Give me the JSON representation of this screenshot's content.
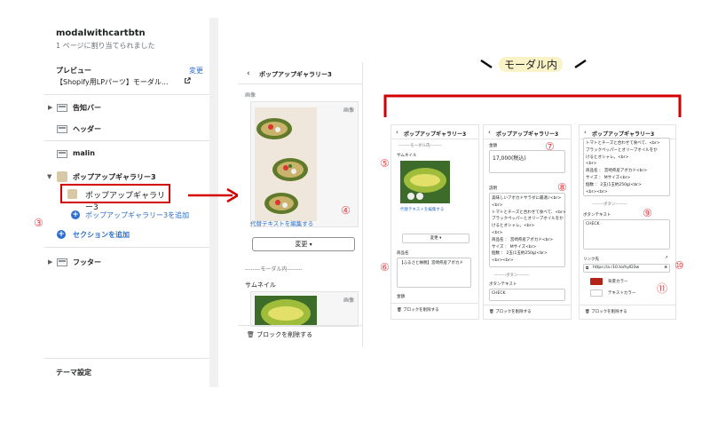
{
  "sidebar": {
    "title": "modalwithcartbtn",
    "subtitle": "1 ページに割り当てられました",
    "preview_label": "プレビュー",
    "change_link": "変更",
    "preview_value": "【Shopify用LPパーツ】モーダル...",
    "sections": {
      "announcement": "告知バー",
      "header": "ヘッダー",
      "malin": "malin",
      "popup_gallery": "ポップアップギャラリー3",
      "popup_block": "ポップアップギャラリー3",
      "add_block": "ポップアップギャラリー3を追加",
      "add_section": "セクションを追加",
      "footer": "フッター"
    },
    "theme_settings": "テーマ設定",
    "marker_3": "③"
  },
  "middle": {
    "header": "ポップアップギャラリー3",
    "image_label": "画像",
    "image_badge": "画像",
    "alt_text_link": "代替テキストを編集する",
    "marker_4": "④",
    "change_button": "変更",
    "modal_divider": "--------モーダル内--------",
    "thumbnail_label": "サムネイル",
    "thumb_badge": "画像",
    "delete_block": "ブロックを削除する"
  },
  "heading": {
    "title": "モーダル内",
    "accent_color": "#d40000"
  },
  "shot1": {
    "header": "ポップアップギャラリー3",
    "divider": "--------モーダル内--------",
    "thumbnail_label": "サムネイル",
    "alt_link": "代替テキストを編集する",
    "change": "変更",
    "product_label": "商品名",
    "product_value": "【ふるさと納税】宮崎県産アボカド",
    "price_label": "金額",
    "delete": "ブロックを削除する",
    "marker_5": "⑤",
    "marker_6": "⑥"
  },
  "shot2": {
    "header": "ポップアップギャラリー3",
    "price_label": "金額",
    "price_value": "17,000(税込)",
    "desc_label": "説明",
    "desc_lines": [
      "美味しいアボカドサラダに最適♪<br>",
      "<br>",
      "トマトとチーズと合わせて食べて、<br>",
      "ブラックペッパーとオリーブオイルをか",
      "けるとオシャレ。<br>",
      "<br>",
      "商品名  ：  宮崎県産アボカド<br>",
      "サイズ  ：  Mサイズ<br>",
      "個数  ：  2玉(1玉約250g)<br>",
      "<br><br>"
    ],
    "button_divider": "--------ボタン--------",
    "button_text_label": "ボタンテキスト",
    "button_text_value": "CHECK",
    "delete": "ブロックを削除する",
    "marker_7": "⑦",
    "marker_8": "⑧"
  },
  "shot3": {
    "header": "ポップアップギャラリー3",
    "desc_lines": [
      "トマトとチーズと合わせて食べて、<br>",
      "ブラックペッパーとオリーブオイルをか",
      "けるとオシャレ。<br>",
      "<br>",
      "商品名  ：  宮崎県産アボカド<br>",
      "サイズ  ：  Mサイズ<br>",
      "個数  ：  2玉(1玉約250g)<br>",
      "<br><br>"
    ],
    "button_divider": "--------ボタン--------",
    "button_text_label": "ボタンテキスト",
    "button_text_value": "CHECK",
    "link_label": "リンク先",
    "link_value": "https://a.r10.to/hylD3w",
    "bg_color_label": "背景カラー",
    "bg_color": "#b42318",
    "text_color_label": "テキストカラー",
    "text_color": "#ffffff",
    "delete": "ブロックを削除する",
    "marker_9": "⑨",
    "marker_10": "⑩",
    "marker_11": "⑪"
  }
}
